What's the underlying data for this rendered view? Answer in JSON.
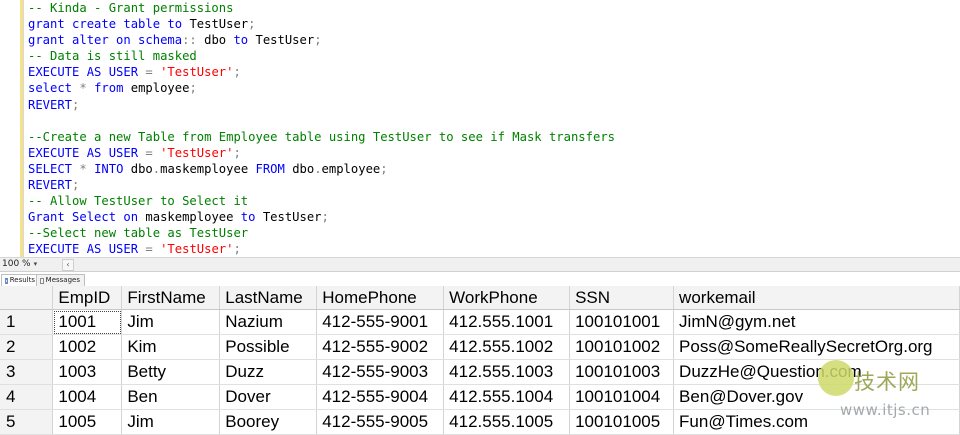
{
  "editor": {
    "lines": [
      [
        {
          "t": "cm",
          "v": "-- Kinda - Grant permissions"
        }
      ],
      [
        {
          "t": "kw",
          "v": "grant create table to "
        },
        {
          "t": "tx",
          "v": "TestUser"
        },
        {
          "t": "op",
          "v": ";"
        }
      ],
      [
        {
          "t": "kw",
          "v": "grant alter on schema"
        },
        {
          "t": "op",
          "v": "::"
        },
        {
          "t": "tx",
          "v": " dbo "
        },
        {
          "t": "kw",
          "v": "to "
        },
        {
          "t": "tx",
          "v": "TestUser"
        },
        {
          "t": "op",
          "v": ";"
        }
      ],
      [
        {
          "t": "cm",
          "v": "-- Data is still masked"
        }
      ],
      [
        {
          "t": "kw",
          "v": "EXECUTE AS USER "
        },
        {
          "t": "op",
          "v": "= "
        },
        {
          "t": "st",
          "v": "'TestUser'"
        },
        {
          "t": "op",
          "v": ";"
        }
      ],
      [
        {
          "t": "kw",
          "v": "select "
        },
        {
          "t": "op",
          "v": "* "
        },
        {
          "t": "kw",
          "v": "from "
        },
        {
          "t": "tx",
          "v": "employee"
        },
        {
          "t": "op",
          "v": ";"
        }
      ],
      [
        {
          "t": "kw",
          "v": "REVERT"
        },
        {
          "t": "op",
          "v": ";"
        }
      ],
      [
        {
          "t": "tx",
          "v": ""
        }
      ],
      [
        {
          "t": "cm",
          "v": "--Create a new Table from Employee table using TestUser to see if Mask transfers"
        }
      ],
      [
        {
          "t": "kw",
          "v": "EXECUTE AS USER "
        },
        {
          "t": "op",
          "v": "= "
        },
        {
          "t": "st",
          "v": "'TestUser'"
        },
        {
          "t": "op",
          "v": ";"
        }
      ],
      [
        {
          "t": "kw",
          "v": "SELECT "
        },
        {
          "t": "op",
          "v": "* "
        },
        {
          "t": "kw",
          "v": "INTO "
        },
        {
          "t": "tx",
          "v": "dbo"
        },
        {
          "t": "op",
          "v": "."
        },
        {
          "t": "tx",
          "v": "maskemployee "
        },
        {
          "t": "kw",
          "v": "FROM "
        },
        {
          "t": "tx",
          "v": "dbo"
        },
        {
          "t": "op",
          "v": "."
        },
        {
          "t": "tx",
          "v": "employee"
        },
        {
          "t": "op",
          "v": ";"
        }
      ],
      [
        {
          "t": "kw",
          "v": "REVERT"
        },
        {
          "t": "op",
          "v": ";"
        }
      ],
      [
        {
          "t": "cm",
          "v": "-- Allow TestUser to Select it"
        }
      ],
      [
        {
          "t": "kw",
          "v": "Grant Select on "
        },
        {
          "t": "tx",
          "v": "maskemployee "
        },
        {
          "t": "kw",
          "v": "to "
        },
        {
          "t": "tx",
          "v": "TestUser"
        },
        {
          "t": "op",
          "v": ";"
        }
      ],
      [
        {
          "t": "cm",
          "v": "--Select new table as TestUser"
        }
      ],
      [
        {
          "t": "kw",
          "v": "EXECUTE AS USER "
        },
        {
          "t": "op",
          "v": "= "
        },
        {
          "t": "st",
          "v": "'TestUser'"
        },
        {
          "t": "op",
          "v": ";"
        }
      ]
    ]
  },
  "zoom": {
    "value": "100 %",
    "arrow": "▾",
    "scroll_left": "‹"
  },
  "tabs": {
    "results": "Results",
    "messages": "Messages"
  },
  "results": {
    "columns": [
      "EmpID",
      "FirstName",
      "LastName",
      "HomePhone",
      "WorkPhone",
      "SSN",
      "workemail"
    ],
    "rows": [
      [
        "1",
        "1001",
        "Jim",
        "Nazium",
        "412-555-9001",
        "412.555.1001",
        "100101001",
        "JimN@gym.net"
      ],
      [
        "2",
        "1002",
        "Kim",
        "Possible",
        "412-555-9002",
        "412.555.1002",
        "100101002",
        "Poss@SomeReallySecretOrg.org"
      ],
      [
        "3",
        "1003",
        "Betty",
        "Duzz",
        "412-555-9003",
        "412.555.1003",
        "100101003",
        "DuzzHe@Question.com"
      ],
      [
        "4",
        "1004",
        "Ben",
        "Dover",
        "412-555-9004",
        "412.555.1004",
        "100101004",
        "Ben@Dover.gov"
      ],
      [
        "5",
        "1005",
        "Jim",
        "Boorey",
        "412-555-9005",
        "412.555.1005",
        "100101005",
        "Fun@Times.com"
      ]
    ]
  },
  "watermark": {
    "line1": "技术网",
    "line2": "www.itjs.cn"
  }
}
